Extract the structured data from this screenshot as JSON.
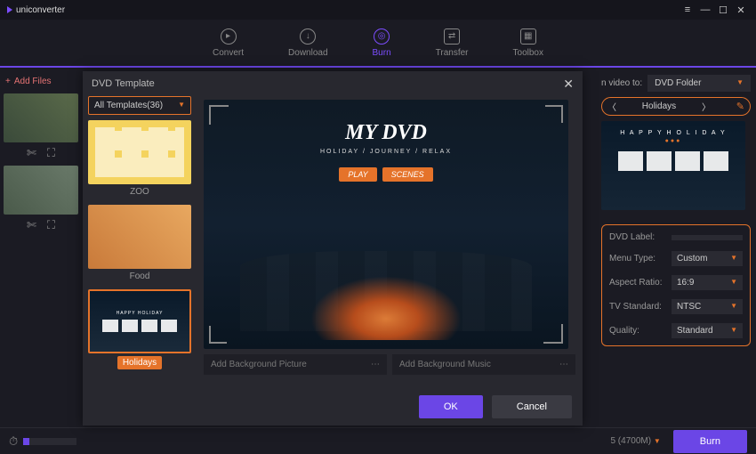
{
  "app": {
    "name": "uniconverter"
  },
  "window": {
    "min": "—",
    "max": "☐",
    "close": "✕",
    "menu": "≡"
  },
  "nav": {
    "convert": "Convert",
    "download": "Download",
    "burn": "Burn",
    "transfer": "Transfer",
    "toolbox": "Toolbox"
  },
  "left": {
    "add_files": "Add Files"
  },
  "modal": {
    "title": "DVD Template",
    "filter": "All Templates(36)",
    "templates": [
      {
        "name": "ZOO"
      },
      {
        "name": "Food"
      },
      {
        "name": "Holidays",
        "selected": true
      }
    ],
    "preview": {
      "title": "MY DVD",
      "subtitle": "HOLIDAY  /  JOURNEY  /  RELAX",
      "play": "PLAY",
      "scenes": "SCENES"
    },
    "bg_picture_placeholder": "Add Background Picture",
    "bg_music_placeholder": "Add Background Music",
    "ok": "OK",
    "cancel": "Cancel"
  },
  "right": {
    "burn_to_label": "n video to:",
    "burn_to_value": "DVD Folder",
    "template_name": "Holidays",
    "hol_title": "H A P P Y  H O L I D A Y",
    "settings": {
      "dvd_label": {
        "label": "DVD Label:",
        "value": ""
      },
      "menu_type": {
        "label": "Menu Type:",
        "value": "Custom"
      },
      "aspect_ratio": {
        "label": "Aspect Ratio:",
        "value": "16:9"
      },
      "tv_standard": {
        "label": "TV Standard:",
        "value": "NTSC"
      },
      "quality": {
        "label": "Quality:",
        "value": "Standard"
      }
    }
  },
  "bottom": {
    "capacity": "5 (4700M)",
    "burn": "Burn"
  }
}
